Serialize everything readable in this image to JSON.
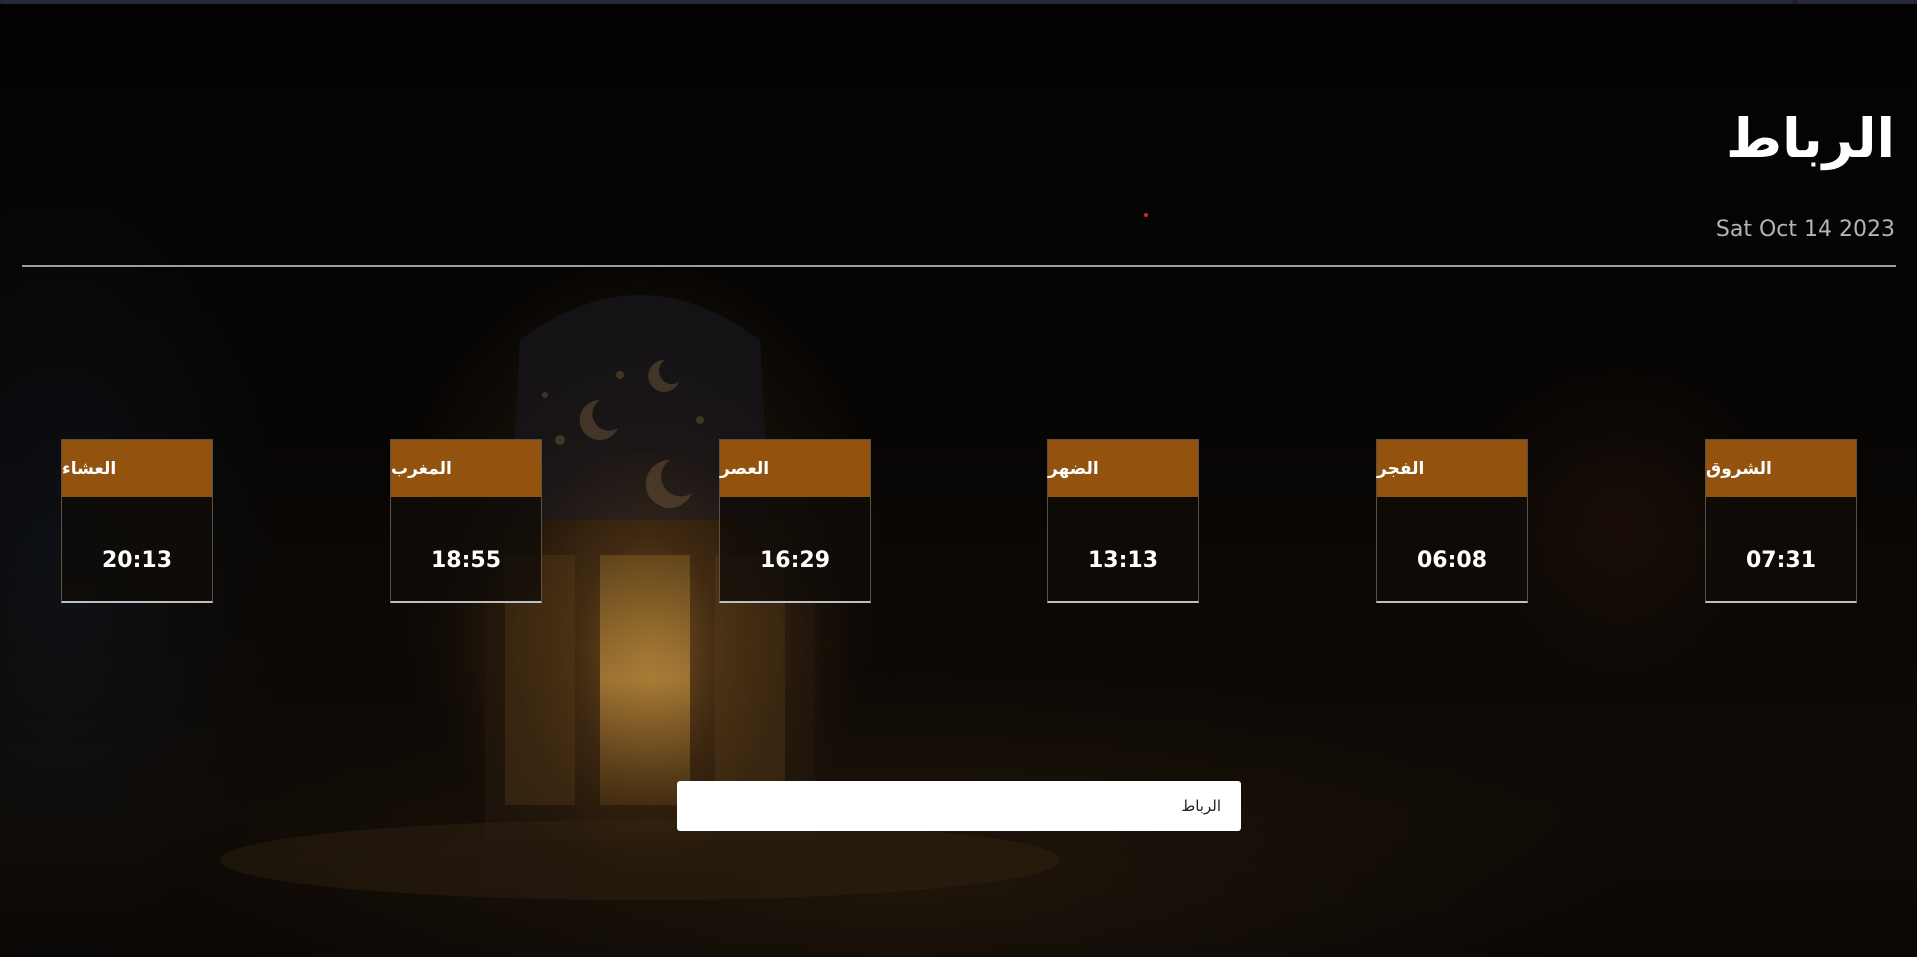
{
  "header": {
    "city_title": "الرباط",
    "date": "Sat Oct 14 2023"
  },
  "prayers": [
    {
      "name": "الشروق",
      "time": "07:31"
    },
    {
      "name": "الفجر",
      "time": "06:08"
    },
    {
      "name": "الضهر",
      "time": "13:13"
    },
    {
      "name": "العصر",
      "time": "16:29"
    },
    {
      "name": "المغرب",
      "time": "18:55"
    },
    {
      "name": "العشاء",
      "time": "20:13"
    }
  ],
  "search": {
    "value": "الرباط"
  },
  "colors": {
    "card_header": "#93520d",
    "background": "#050403",
    "title_text": "#ffffff",
    "date_text": "#b4b4b4"
  }
}
